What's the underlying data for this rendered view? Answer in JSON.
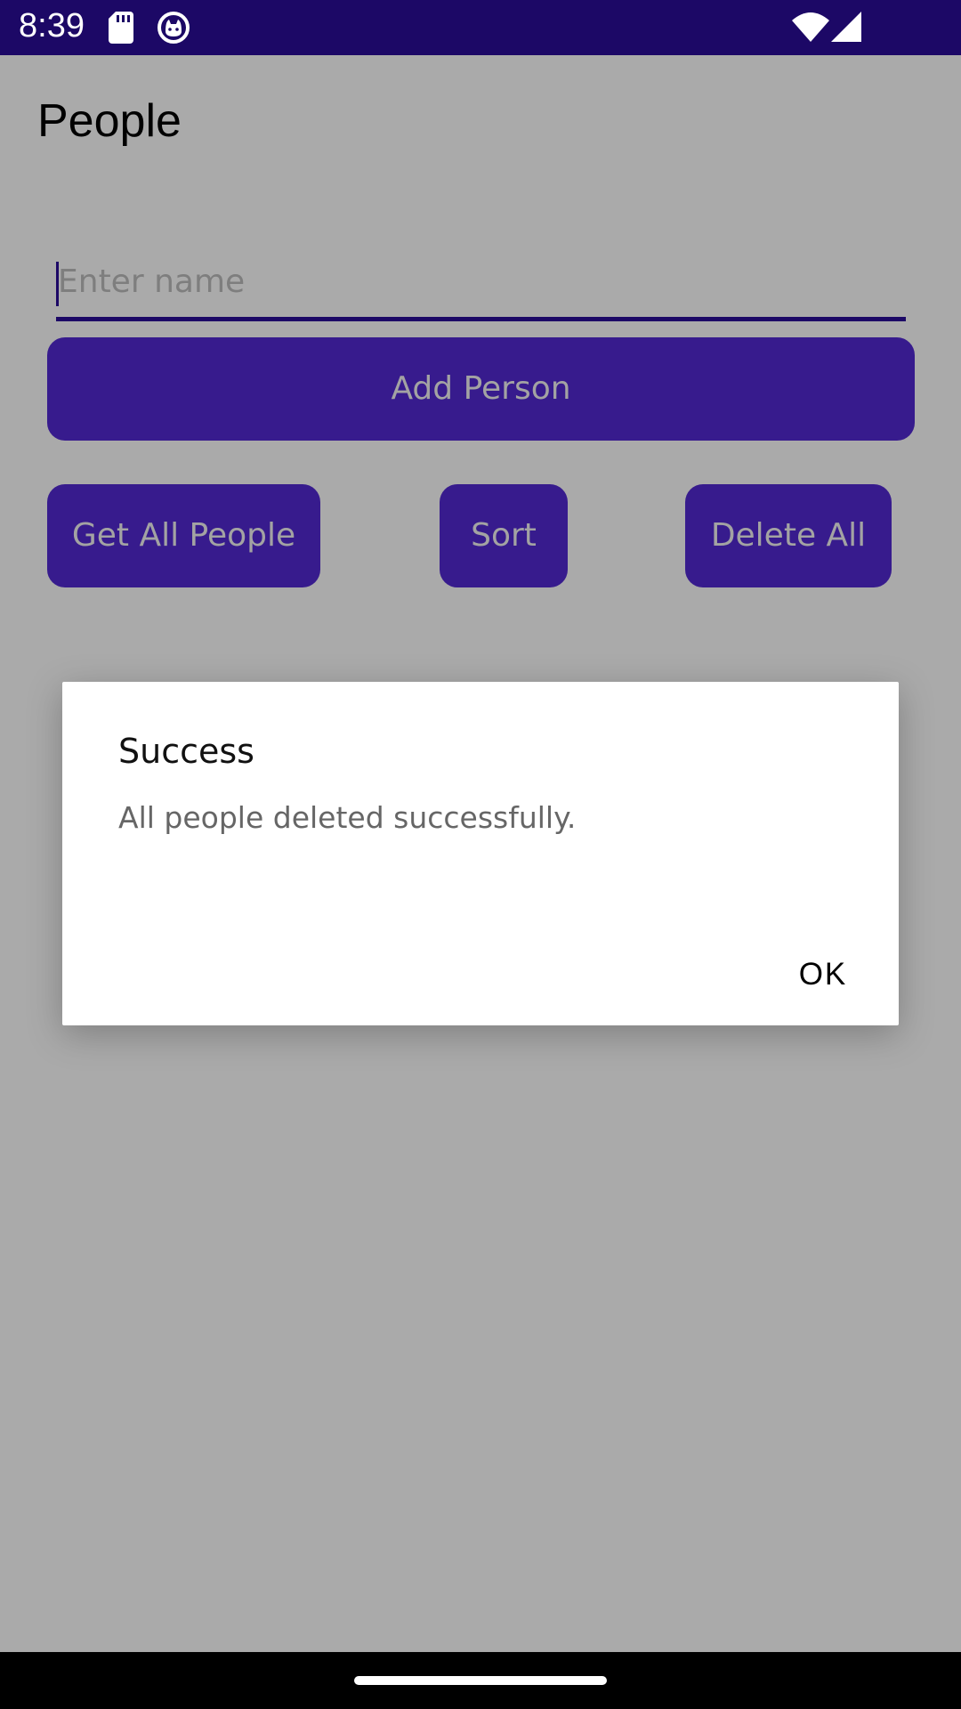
{
  "status_bar": {
    "time": "8:39",
    "icons": [
      "sd-card-icon",
      "cat-face-icon",
      "wifi-icon",
      "signal-icon"
    ]
  },
  "page": {
    "title": "People"
  },
  "form": {
    "name_placeholder": "Enter name",
    "name_value": "",
    "add_button_label": "Add Person"
  },
  "actions": {
    "get_all_label": "Get All People",
    "sort_label": "Sort",
    "delete_all_label": "Delete All"
  },
  "dialog": {
    "title": "Success",
    "message": "All people deleted successfully.",
    "ok_label": "OK"
  },
  "colors": {
    "status_bar": "#1c0866",
    "button_bg_dimmed": "#371b8d",
    "scrim_background": "#aaaaaa",
    "dialog_bg": "#ffffff"
  }
}
